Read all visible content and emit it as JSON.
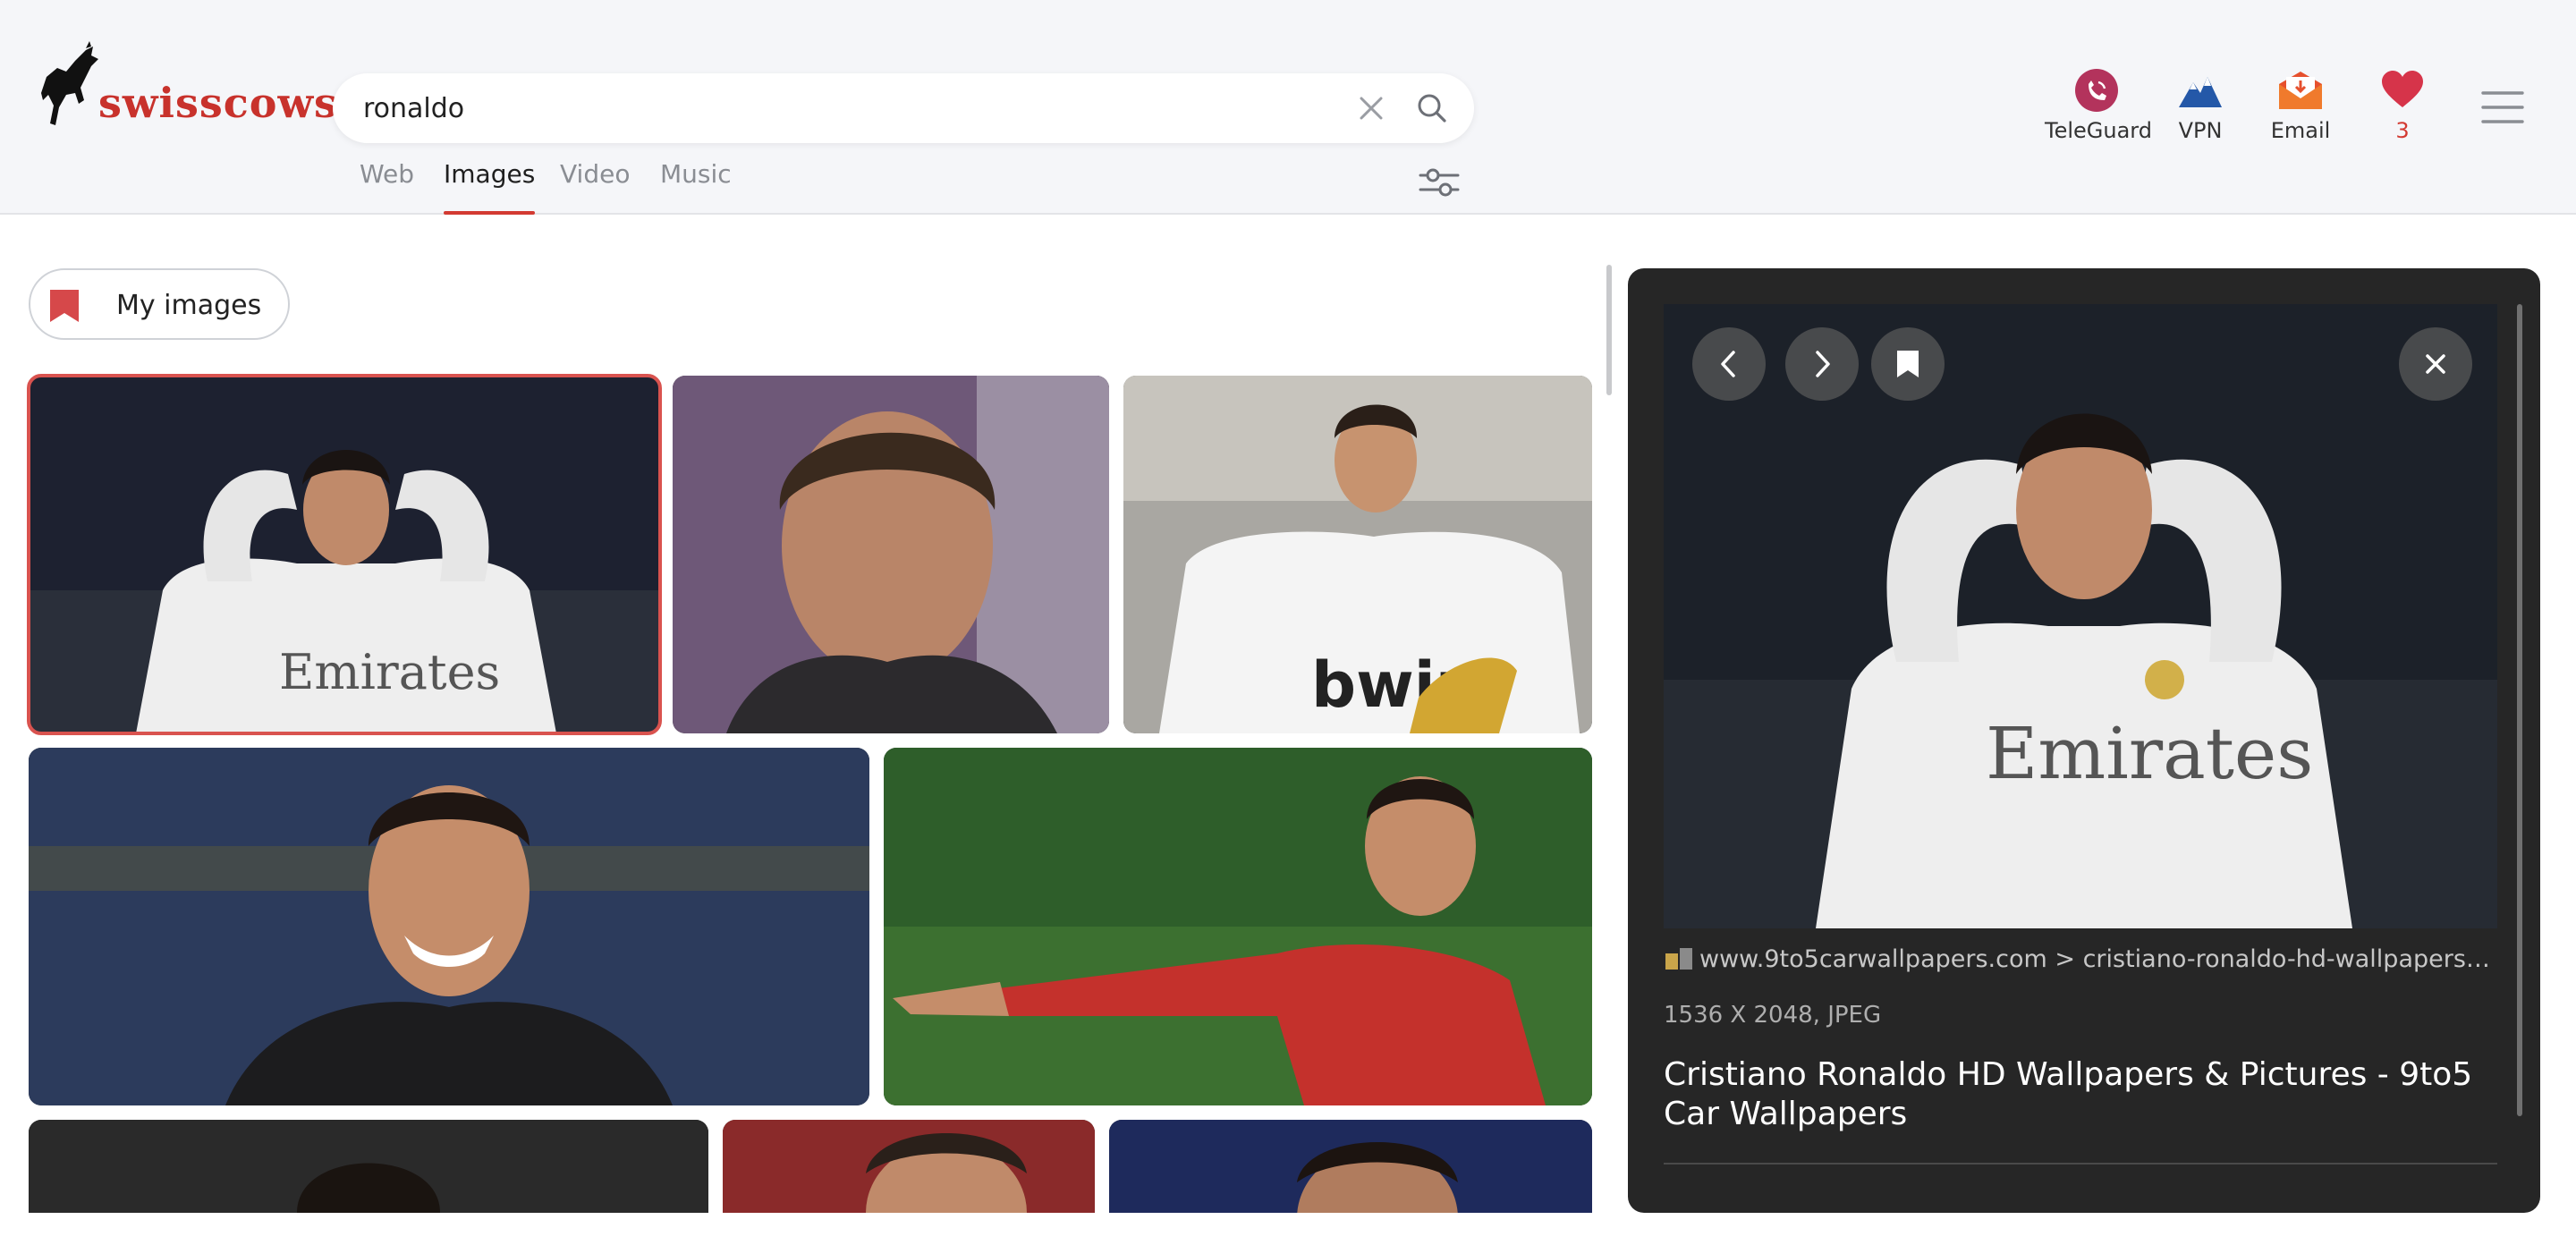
{
  "brand": {
    "name": "swisscows"
  },
  "search": {
    "query": "ronaldo",
    "clear_icon": "close-icon",
    "submit_icon": "search-icon"
  },
  "tabs": [
    {
      "label": "Web",
      "active": false
    },
    {
      "label": "Images",
      "active": true
    },
    {
      "label": "Video",
      "active": false
    },
    {
      "label": "Music",
      "active": false
    }
  ],
  "topnav": {
    "teleguard": {
      "label": "TeleGuard",
      "icon": "teleguard-icon"
    },
    "vpn": {
      "label": "VPN",
      "icon": "vpn-mountain-icon"
    },
    "email": {
      "label": "Email",
      "icon": "email-icon"
    },
    "favorites": {
      "count": "3",
      "icon": "heart-icon"
    }
  },
  "my_images": {
    "label": "My images",
    "icon": "bookmark-icon"
  },
  "results": {
    "thumbnails": [
      {
        "alt": "Ronaldo hands on head, white Emirates kit",
        "selected": true
      },
      {
        "alt": "Ronaldo close-up face",
        "selected": false
      },
      {
        "alt": "Ronaldo with golden boot",
        "selected": false
      },
      {
        "alt": "Ronaldo smiling, black jacket",
        "selected": false
      },
      {
        "alt": "Ronaldo pointing, red Portugal kit",
        "selected": false
      },
      {
        "alt": "Ronaldo dark jersey",
        "selected": false
      },
      {
        "alt": "Ronaldo red kit",
        "selected": false
      },
      {
        "alt": "Ronaldo blue background",
        "selected": false
      }
    ]
  },
  "preview": {
    "source": "www.9to5carwallpapers.com > cristiano-ronaldo-hd-wallpapers-pict...",
    "meta": "1536 X 2048, JPEG",
    "title": "Cristiano Ronaldo HD Wallpapers & Pictures - 9to5 Car Wallpapers",
    "buttons": [
      "prev-icon",
      "next-icon",
      "bookmark-icon",
      "close-icon"
    ]
  },
  "colors": {
    "accent": "#d33a32",
    "panel_bg": "#262626",
    "header_bg": "#f5f6f9"
  }
}
